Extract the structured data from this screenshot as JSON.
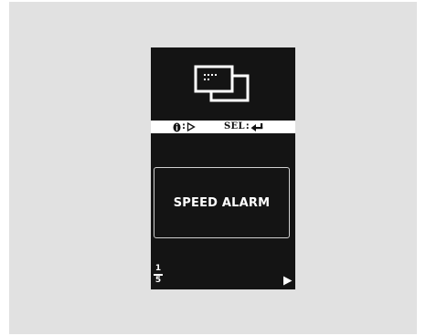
{
  "display": {
    "info_bar": {
      "info_button_icon": "info-i-icon",
      "info_separator": ":",
      "info_action_icon": "play-outline-icon",
      "sel_label": "SEL",
      "sel_separator": ":",
      "sel_action_icon": "enter-return-icon"
    },
    "menu_item": {
      "label": "SPEED ALARM"
    },
    "page_indicator": {
      "current": "1",
      "total": "5"
    },
    "next_icon": "play-filled-icon"
  }
}
